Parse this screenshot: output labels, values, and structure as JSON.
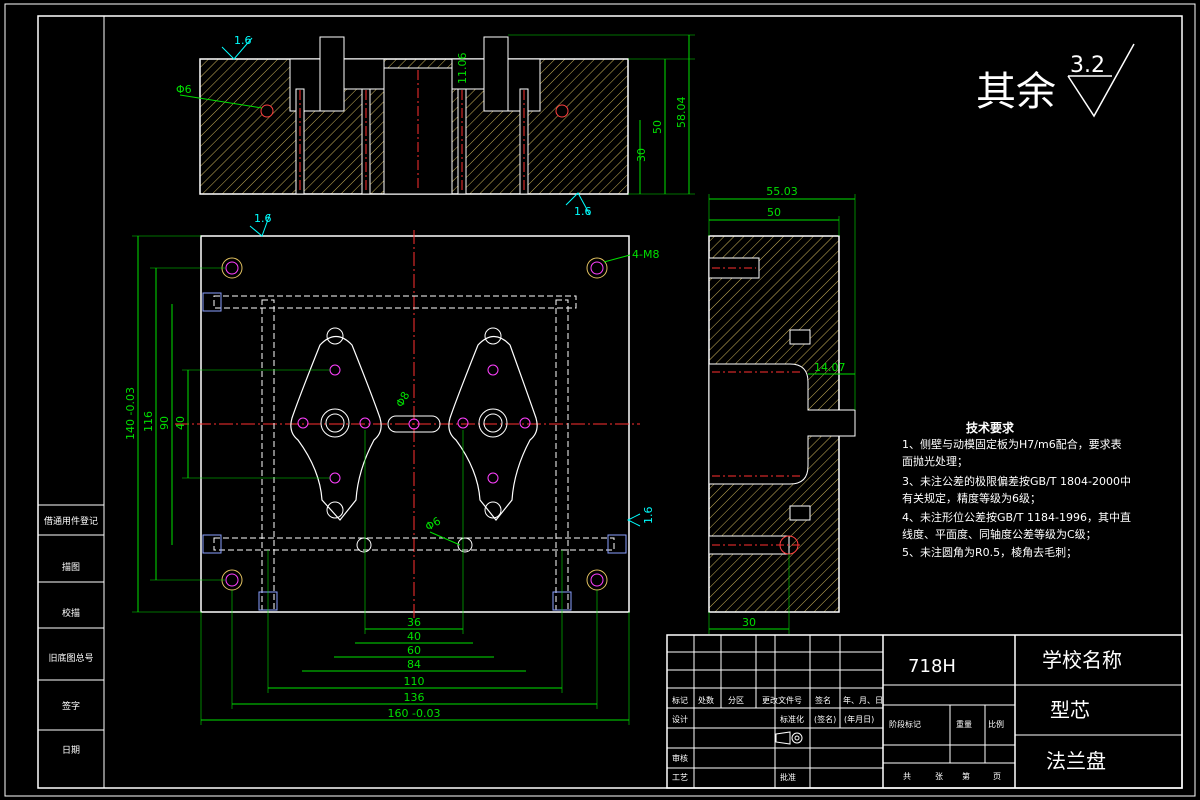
{
  "surface_finish": {
    "label": "其余",
    "value": "3.2"
  },
  "top_view": {
    "roughness_top": "1.6",
    "roughness_bottom": "1.6",
    "hole_dia": "Φ6",
    "dims": [
      "11.06",
      "30",
      "50",
      "58.04"
    ]
  },
  "plan_view": {
    "roughness": "1.6",
    "roughness_right": "1.6",
    "thread_label": "4-M8",
    "hole_dia": "Φ6",
    "hole_dia_small": "Φ8",
    "vertical_dims": [
      "140 -0.03",
      "116",
      "90",
      "40"
    ],
    "horizontal_dims": [
      "36",
      "40",
      "60",
      "84",
      "110",
      "136",
      "160 -0.03"
    ]
  },
  "side_view": {
    "dims_top": [
      "55.03",
      "50"
    ],
    "dim_mid": "14.07",
    "dim_bottom": "30"
  },
  "tech_requirements": {
    "title": "技术要求",
    "items": [
      "1、侧壁与动模固定板为H7/m6配合，要求表",
      "    面抛光处理；",
      "3、未注公差的极限偏差按GB/T 1804-2000中",
      "    有关规定，精度等级为6级；",
      "4、未注形位公差按GB/T 1184-1996，其中直",
      "    线度、平面度、同轴度公差等级为C级；",
      "5、未注圆角为R0.5，棱角去毛刺；"
    ]
  },
  "left_strip": {
    "labels": [
      "借通用件登记",
      "描图",
      "校描",
      "旧底图总号",
      "签字",
      "日期"
    ]
  },
  "title_block": {
    "material": "718H",
    "school": "学校名称",
    "part_name": "型芯",
    "product": "法兰盘",
    "header_cells": [
      "标记",
      "处数",
      "分区",
      "更改文件号",
      "签名",
      "年、月、日"
    ],
    "row_labels": [
      "设计",
      "审核",
      "工艺"
    ],
    "std_label": "标准化",
    "sign_label": "(签名)",
    "date_label": "(年月日)",
    "approve_label": "批准",
    "stage_cells": [
      "阶段标记",
      "重量",
      "比例"
    ],
    "sheet_cells": [
      "共",
      "张",
      "第",
      "页"
    ]
  }
}
